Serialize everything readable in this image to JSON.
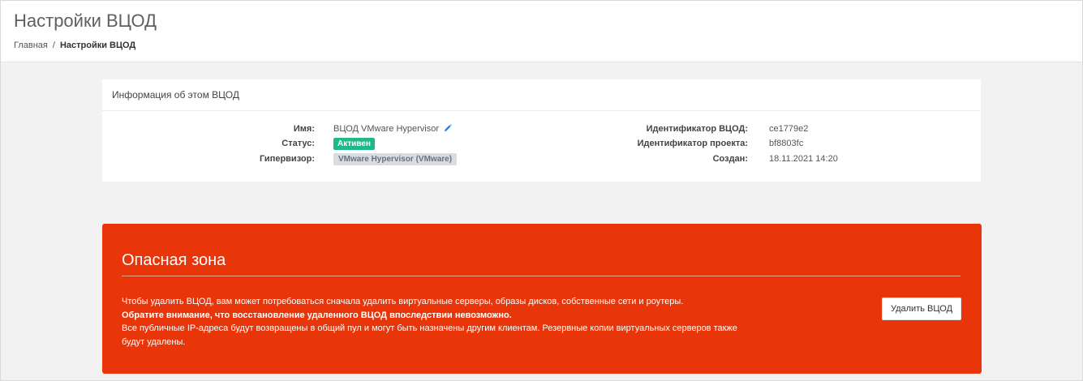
{
  "header": {
    "title": "Настройки ВЦОД",
    "breadcrumb": {
      "home": "Главная",
      "separator": "/",
      "current": "Настройки ВЦОД"
    }
  },
  "info": {
    "title": "Информация об этом ВЦОД",
    "left": [
      {
        "label": "Имя:",
        "value": "ВЦОД VMware Hypervisor"
      },
      {
        "label": "Статус:",
        "value": "Активен"
      },
      {
        "label": "Гипервизор:",
        "value": "VMware Hypervisor (VMware)"
      }
    ],
    "right": [
      {
        "label": "Идентификатор ВЦОД:",
        "value": "ce1779e2"
      },
      {
        "label": "Идентификатор проекта:",
        "value": "bf8803fc"
      },
      {
        "label": "Создан:",
        "value": "18.11.2021 14:20"
      }
    ],
    "edit_icon": "pencil-icon"
  },
  "danger": {
    "title": "Опасная зона",
    "line1": "Чтобы удалить ВЦОД, вам может потребоваться сначала удалить виртуальные серверы, образы дисков, собственные сети и роутеры.",
    "line2": "Обратите внимание, что восстановление удаленного ВЦОД впоследствии невозможно.",
    "line3": "Все публичные IP-адреса будут возвращены в общий пул и могут быть назначены другим клиентам. Резервные копии виртуальных серверов также будут удалены.",
    "delete_label": "Удалить ВЦОД"
  },
  "colors": {
    "danger_bg": "#e8360a",
    "status_active": "#1fb989",
    "edit_icon": "#2a7de1"
  }
}
